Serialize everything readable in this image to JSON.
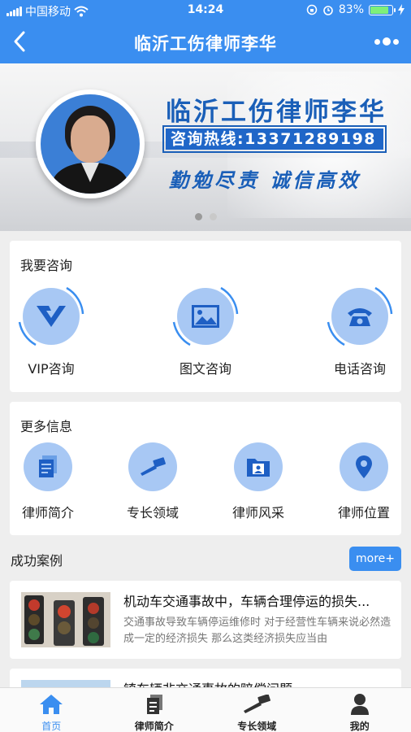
{
  "status_bar": {
    "carrier": "中国移动",
    "time": "14:24",
    "battery": "83%",
    "battery_level": 0.83
  },
  "nav": {
    "title": "临沂工伤律师李华",
    "back_icon": "back-arrow-icon",
    "more_icon": "more-dots-icon"
  },
  "banner": {
    "name": "临沂工伤律师李华",
    "hotline": "咨询热线:13371289198",
    "slogan": "勤勉尽责 诚信高效",
    "slides": 2,
    "active_slide": 1
  },
  "consult": {
    "title": "我要咨询",
    "items": [
      {
        "label": "VIP咨询",
        "icon": "vip-icon"
      },
      {
        "label": "图文咨询",
        "icon": "image-icon"
      },
      {
        "label": "电话咨询",
        "icon": "telephone-icon"
      }
    ]
  },
  "more_info": {
    "title": "更多信息",
    "items": [
      {
        "label": "律师简介",
        "icon": "document-icon"
      },
      {
        "label": "专长领域",
        "icon": "gavel-icon"
      },
      {
        "label": "律师风采",
        "icon": "folder-person-icon"
      },
      {
        "label": "律师位置",
        "icon": "location-pin-icon"
      }
    ]
  },
  "cases": {
    "title": "成功案例",
    "more_label": "more+",
    "items": [
      {
        "title": "机动车交通事故中，车辆合理停运的损失...",
        "desc": "交通事故导致车辆停运维修时 对于经营性车辆来说必然造成一定的经济损失 那么这类经济损失应当由"
      },
      {
        "title": "镇车辆非交通事故的赔偿问题",
        "desc": ""
      }
    ]
  },
  "tabbar": {
    "items": [
      {
        "label": "首页",
        "icon": "home-icon",
        "active": true
      },
      {
        "label": "律师简介",
        "icon": "document-icon",
        "active": false
      },
      {
        "label": "专长领域",
        "icon": "gavel-icon",
        "active": false
      },
      {
        "label": "我的",
        "icon": "user-icon",
        "active": false
      }
    ]
  },
  "colors": {
    "primary": "#3a8ef0",
    "icon_bg": "#a8c8f4",
    "banner_text": "#1a5fb8"
  }
}
